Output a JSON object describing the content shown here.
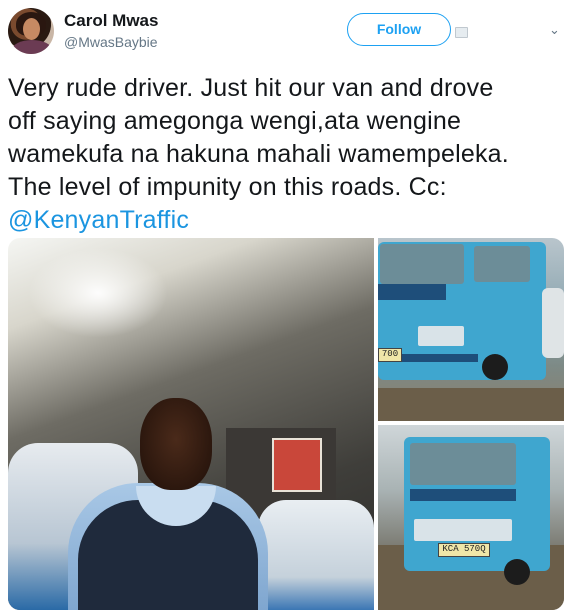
{
  "author": {
    "name": "Carol Mwas",
    "handle": "@MwasBaybie"
  },
  "follow_label": "Follow",
  "tweet": {
    "lines": [
      "Very rude driver. Just hit our van and drove",
      "off saying amegonga wengi,ata wengine",
      "wamekufa na hakuna mahali wamempeleka.",
      "The level of impunity on this roads.  Cc:"
    ],
    "mention": "@KenyanTraffic"
  },
  "photos": {
    "top_right_plate": "700",
    "bottom_right_plate": "KCA 570Q"
  },
  "colors": {
    "accent": "#1da1f2",
    "mention": "#1b95e0",
    "bus_body": "#3fa6cf"
  },
  "icons": {
    "caret": "chevron-down-icon",
    "follow_extra": "user-card-icon"
  }
}
